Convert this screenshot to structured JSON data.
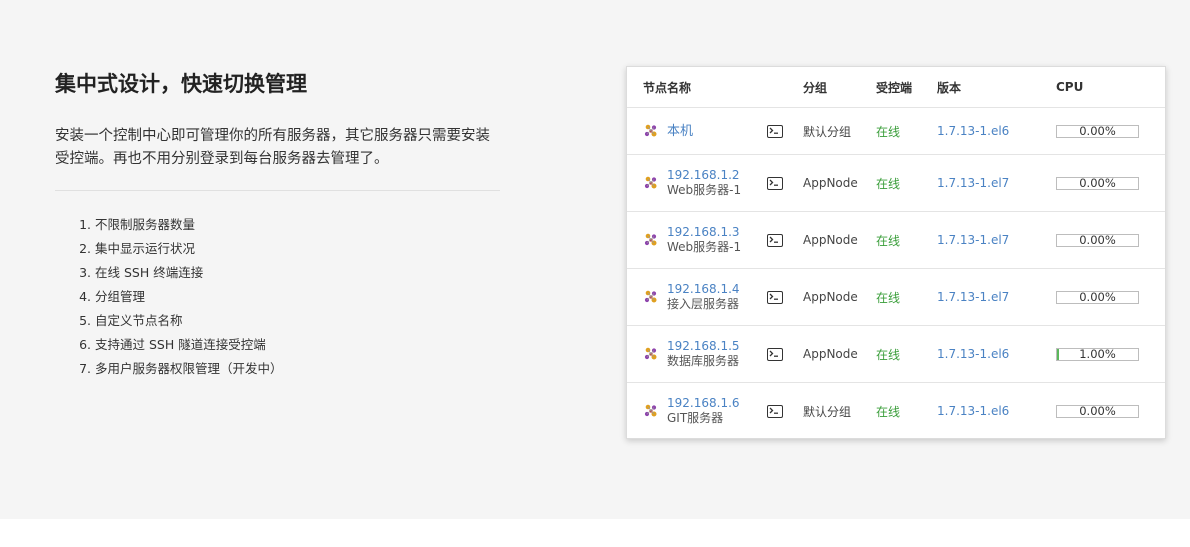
{
  "section": {
    "title": "集中式设计，快速切换管理",
    "description": "安装一个控制中心即可管理你的所有服务器，其它服务器只需要安装受控端。再也不用分别登录到每台服务器去管理了。",
    "features": [
      "不限制服务器数量",
      "集中显示运行状况",
      "在线 SSH 终端连接",
      "分组管理",
      "自定义节点名称",
      "支持通过 SSH 隧道连接受控端",
      "多用户服务器权限管理（开发中）"
    ]
  },
  "table": {
    "headers": {
      "name": "节点名称",
      "group": "分组",
      "controlled": "受控端",
      "version": "版本",
      "cpu": "CPU"
    },
    "rows": [
      {
        "name": "本机",
        "label": "",
        "group": "默认分组",
        "status": "在线",
        "version": "1.7.13-1.el6",
        "cpu_text": "0.00%",
        "cpu_percent": 0
      },
      {
        "name": "192.168.1.2",
        "label": "Web服务器-1",
        "group": "AppNode",
        "status": "在线",
        "version": "1.7.13-1.el7",
        "cpu_text": "0.00%",
        "cpu_percent": 0
      },
      {
        "name": "192.168.1.3",
        "label": "Web服务器-1",
        "group": "AppNode",
        "status": "在线",
        "version": "1.7.13-1.el7",
        "cpu_text": "0.00%",
        "cpu_percent": 0
      },
      {
        "name": "192.168.1.4",
        "label": "接入层服务器",
        "group": "AppNode",
        "status": "在线",
        "version": "1.7.13-1.el7",
        "cpu_text": "0.00%",
        "cpu_percent": 0
      },
      {
        "name": "192.168.1.5",
        "label": "数据库服务器",
        "group": "AppNode",
        "status": "在线",
        "version": "1.7.13-1.el6",
        "cpu_text": "1.00%",
        "cpu_percent": 1
      },
      {
        "name": "192.168.1.6",
        "label": "GIT服务器",
        "group": "默认分组",
        "status": "在线",
        "version": "1.7.13-1.el6",
        "cpu_text": "0.00%",
        "cpu_percent": 0
      }
    ]
  },
  "colors": {
    "link": "#4a82c3",
    "online": "#3a9e3a",
    "cpu_fill": "#5cb85c"
  },
  "icons": {
    "node": "cluster-node-icon",
    "terminal": "terminal-icon"
  }
}
